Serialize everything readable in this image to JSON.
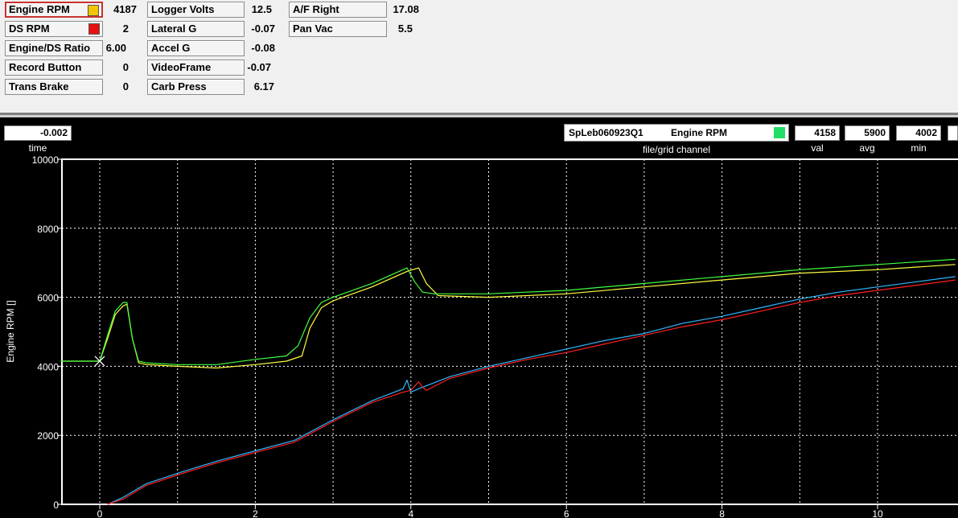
{
  "channels": [
    {
      "label": "Engine RPM",
      "value": "4187",
      "swatch": "#f5c400",
      "selected": true
    },
    {
      "label": "DS RPM",
      "value": "2",
      "swatch": "#e81010",
      "selected": false
    },
    {
      "label": "Engine/DS Ratio",
      "value": "6.00"
    },
    {
      "label": "Record Button",
      "value": "0"
    },
    {
      "label": "Trans Brake",
      "value": "0"
    },
    {
      "label": "Logger Volts",
      "value": "12.5"
    },
    {
      "label": "Lateral G",
      "value": "-0.07"
    },
    {
      "label": "Accel G",
      "value": "-0.08"
    },
    {
      "label": "VideoFrame",
      "value": "-0.07"
    },
    {
      "label": "Carb Press",
      "value": "6.17"
    },
    {
      "label": "A/F Right",
      "value": "17.08"
    },
    {
      "label": "Pan Vac",
      "value": "5.5"
    }
  ],
  "cursor": {
    "time_value": "-0.002",
    "time_label": "time"
  },
  "file_grid": {
    "file": "SpLeb060923Q1",
    "channel": "Engine RPM",
    "label": "file/grid channel",
    "swatch": "#22dd66"
  },
  "stats": [
    {
      "value": "4158",
      "label": "val"
    },
    {
      "value": "5900",
      "label": "avg"
    },
    {
      "value": "4002",
      "label": "min"
    }
  ],
  "chart_data": {
    "type": "line",
    "ylabel": "Engine RPM []",
    "ylim": [
      0,
      10000
    ],
    "xlim": [
      -0.5,
      11
    ],
    "y_ticks": [
      "0",
      "2000",
      "4000",
      "6000",
      "8000",
      "10000"
    ],
    "x_ticks": [
      "0",
      "2",
      "4",
      "6",
      "8",
      "10"
    ],
    "y_tick_values": [
      0,
      2000,
      4000,
      6000,
      8000,
      10000
    ],
    "x_tick_values": [
      0,
      2,
      4,
      6,
      8,
      10
    ],
    "x_grid": [
      0,
      1,
      2,
      3,
      4,
      5,
      6,
      7,
      8,
      9,
      10
    ],
    "grid": true,
    "cursor_x": 0,
    "series": [
      {
        "color": "#ffff40",
        "x": [
          -0.5,
          0,
          0.1,
          0.2,
          0.3,
          0.35,
          0.42,
          0.5,
          0.6,
          1,
          1.5,
          2,
          2.4,
          2.6,
          2.7,
          2.85,
          3,
          3.5,
          3.95,
          4.1,
          4.2,
          4.35,
          5,
          6,
          7,
          8,
          9,
          10,
          11
        ],
        "y": [
          4150,
          4150,
          4800,
          5500,
          5750,
          5800,
          4800,
          4100,
          4050,
          4000,
          3950,
          4050,
          4150,
          4300,
          5100,
          5700,
          5900,
          6300,
          6750,
          6850,
          6400,
          6050,
          6000,
          6100,
          6300,
          6500,
          6700,
          6800,
          6950
        ]
      },
      {
        "color": "#40ff40",
        "x": [
          -0.5,
          0,
          0.1,
          0.2,
          0.3,
          0.35,
          0.42,
          0.5,
          0.6,
          1,
          1.5,
          2,
          2.4,
          2.55,
          2.7,
          2.85,
          3,
          3.5,
          3.95,
          4.05,
          4.15,
          4.3,
          5,
          6,
          7,
          8,
          9,
          10,
          11
        ],
        "y": [
          4150,
          4150,
          4900,
          5600,
          5850,
          5850,
          4800,
          4150,
          4100,
          4050,
          4050,
          4200,
          4300,
          4600,
          5400,
          5850,
          6000,
          6400,
          6850,
          6450,
          6150,
          6100,
          6100,
          6200,
          6400,
          6600,
          6800,
          6950,
          7100
        ]
      },
      {
        "color": "#30b8ff",
        "x": [
          0.1,
          0.3,
          0.6,
          1,
          1.5,
          2,
          2.5,
          3,
          3.5,
          3.9,
          3.95,
          4,
          4.1,
          4.5,
          5,
          5.5,
          6,
          6.5,
          7,
          7.5,
          8,
          8.5,
          9,
          9.5,
          10,
          10.5,
          11
        ],
        "y": [
          0,
          200,
          600,
          900,
          1250,
          1550,
          1850,
          2450,
          3000,
          3350,
          3600,
          3250,
          3350,
          3700,
          4000,
          4250,
          4500,
          4750,
          4950,
          5250,
          5450,
          5700,
          5950,
          6150,
          6300,
          6450,
          6600
        ]
      },
      {
        "color": "#ff2020",
        "x": [
          0.1,
          0.3,
          0.6,
          1,
          1.5,
          2,
          2.5,
          3,
          3.5,
          3.9,
          4,
          4.1,
          4.15,
          4.2,
          4.5,
          5,
          5.5,
          6,
          6.5,
          7,
          7.5,
          8,
          8.5,
          9,
          9.5,
          10,
          10.5,
          11
        ],
        "y": [
          0,
          150,
          550,
          850,
          1200,
          1500,
          1800,
          2400,
          2950,
          3250,
          3300,
          3550,
          3400,
          3300,
          3650,
          3950,
          4200,
          4400,
          4650,
          4900,
          5150,
          5350,
          5600,
          5850,
          6050,
          6200,
          6350,
          6500
        ]
      }
    ]
  }
}
